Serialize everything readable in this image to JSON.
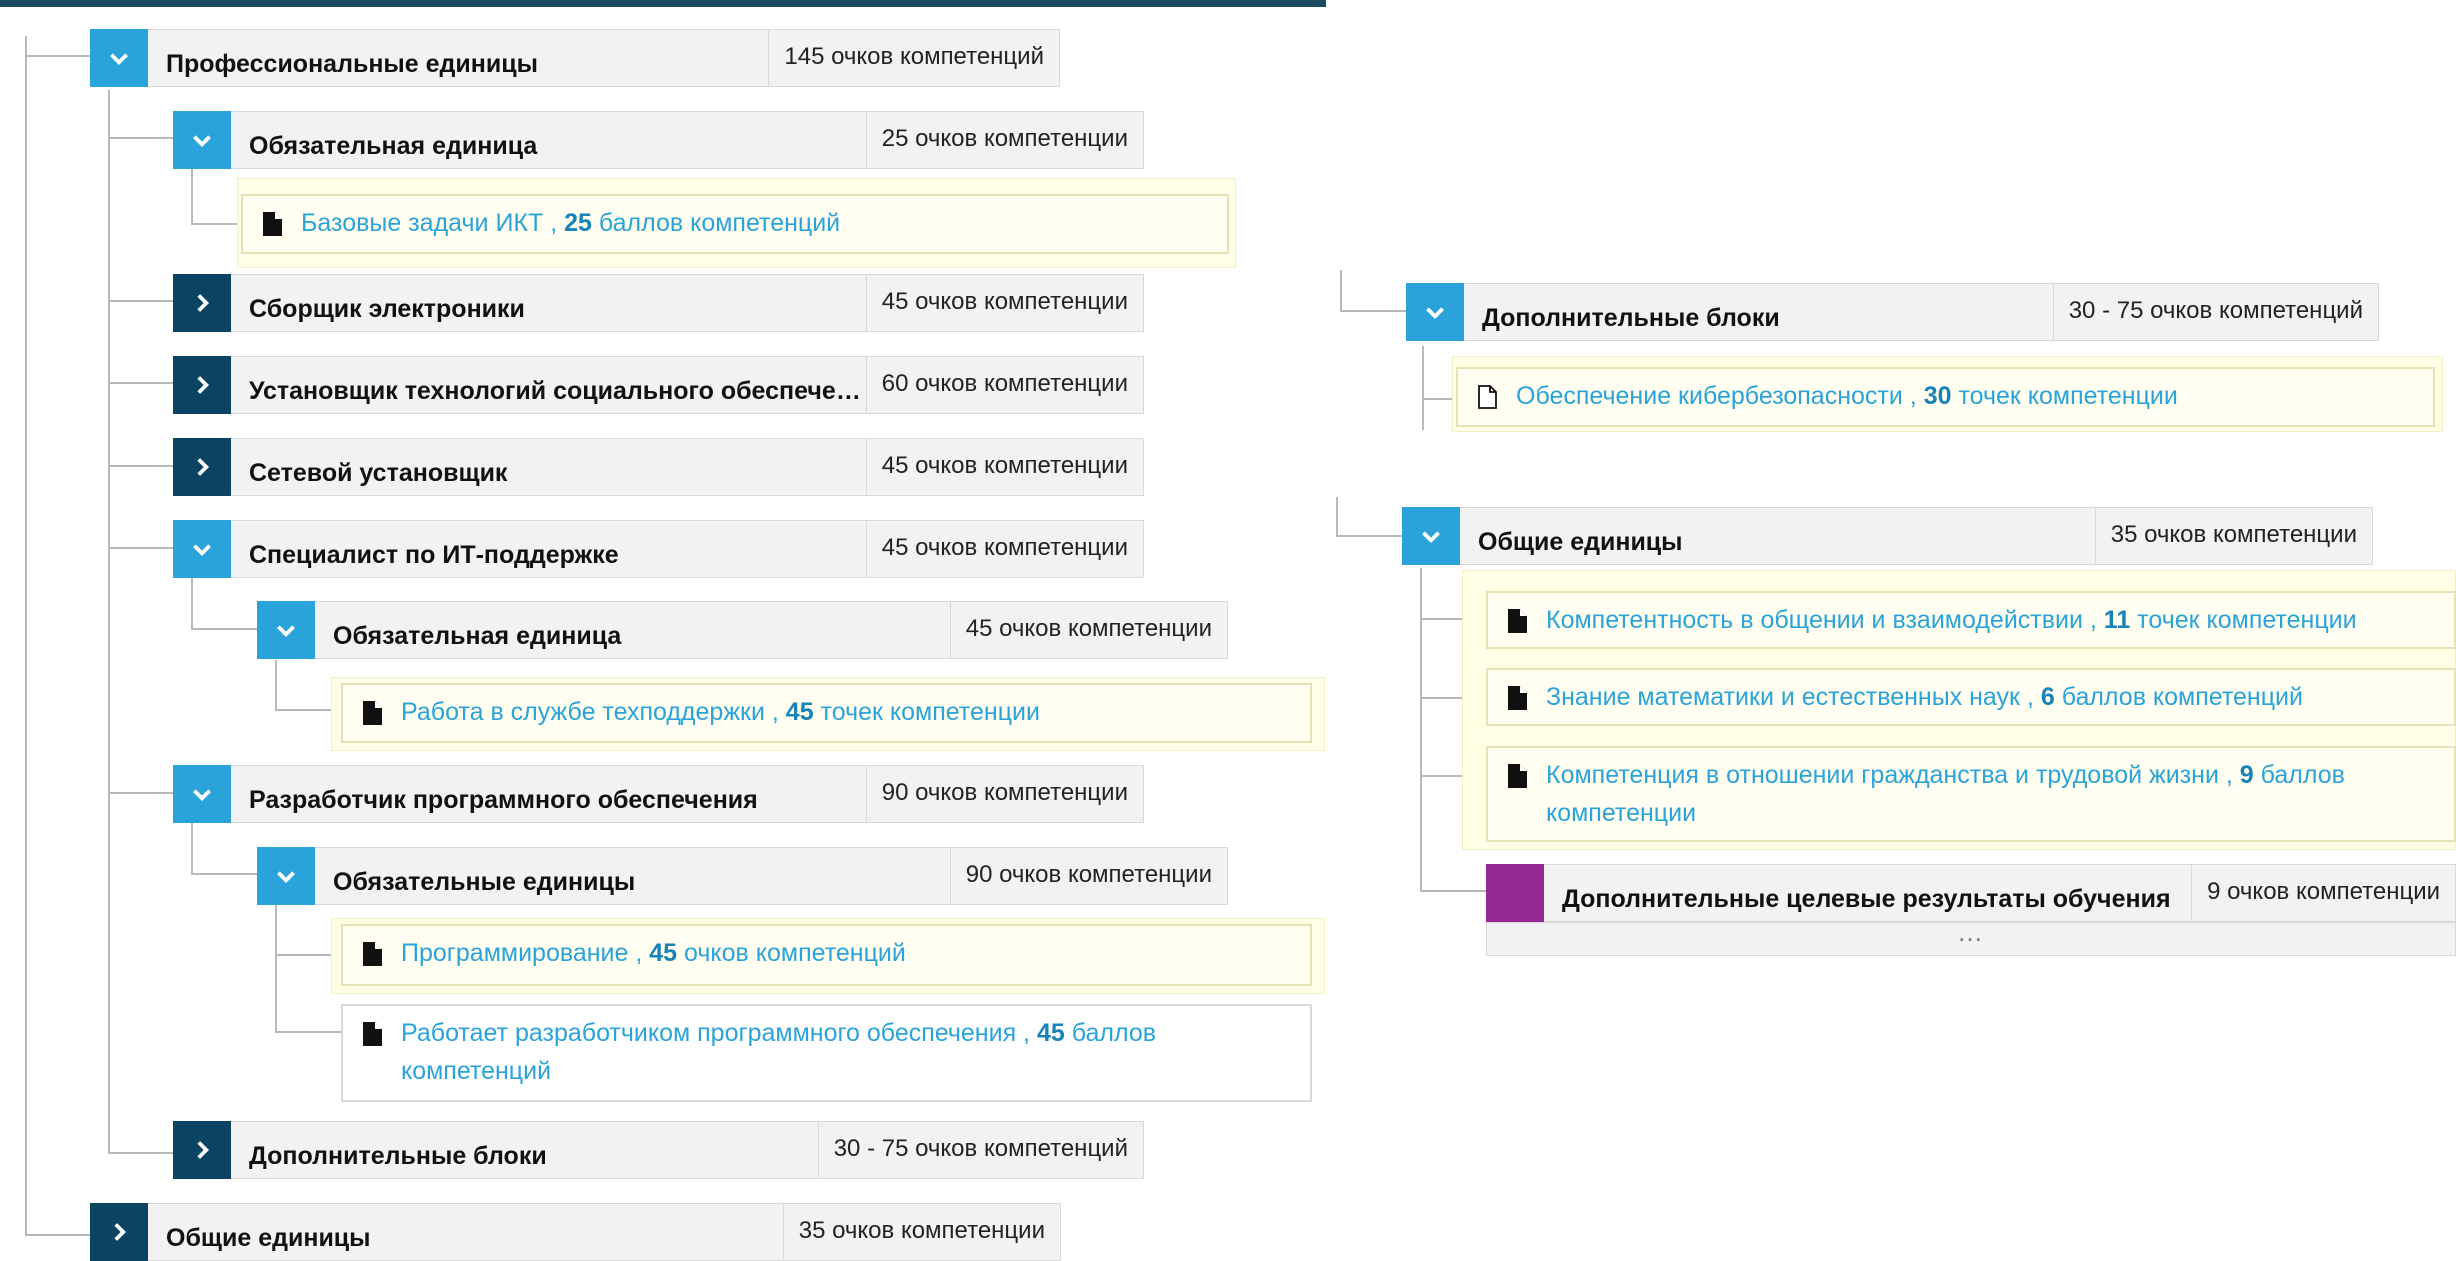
{
  "left": {
    "prof": {
      "title": "Профессиональные единицы",
      "points": "145 очков компетенций"
    },
    "mand1": {
      "title": "Обязательная единица",
      "points": "25 очков компетенции"
    },
    "leaf_ict": {
      "name": "Базовые задачи ИКТ",
      "sep": " , ",
      "num": "25",
      "unit": " баллов компетенций"
    },
    "elec": {
      "title": "Сборщик электроники",
      "points": "45 очков компетенции"
    },
    "social": {
      "title": "Установщик технологий социального обеспечения",
      "points": "60 очков компетенции"
    },
    "net": {
      "title": "Сетевой установщик",
      "points": "45 очков компетенции"
    },
    "itsup": {
      "title": "Специалист по ИТ-поддержке",
      "points": "45 очков компетенции"
    },
    "mand2": {
      "title": "Обязательная единица",
      "points": "45 очков компетенции"
    },
    "leaf_helpdesk": {
      "name": "Работа в службе техподдержки",
      "sep": " , ",
      "num": "45",
      "unit": " точек компетенции"
    },
    "dev": {
      "title": "Разработчик программного обеспечения",
      "points": "90 очков компетенции"
    },
    "mand3": {
      "title": "Обязательные единицы",
      "points": "90 очков компетенции"
    },
    "leaf_prog": {
      "name": "Программирование",
      "sep": " , ",
      "num": "45",
      "unit": " очков компетенций"
    },
    "leaf_devwork": {
      "name": "Работает разработчиком программного обеспечения",
      "sep": " , ",
      "num": "45",
      "unit": " баллов компетенций"
    },
    "extra": {
      "title": "Дополнительные блоки",
      "points": "30 - 75 очков компетенций"
    },
    "general": {
      "title": "Общие единицы",
      "points": "35 очков компетенции"
    }
  },
  "right": {
    "extra": {
      "title": "Дополнительные блоки",
      "points": "30 - 75 очков компетенций"
    },
    "leaf_cyber": {
      "name": "Обеспечение кибербезопасности",
      "sep": " , ",
      "num": "30",
      "unit": " точек компетенции"
    },
    "general": {
      "title": "Общие единицы",
      "points": "35 очков компетенции"
    },
    "leaf_comm": {
      "name": "Компетентность в общении и взаимодействии",
      "sep": " , ",
      "num": "11",
      "unit": " точек компетенции"
    },
    "leaf_math": {
      "name": "Знание математики и естественных наук",
      "sep": " , ",
      "num": "6",
      "unit": " баллов компетенций"
    },
    "leaf_civic": {
      "name": "Компетенция в отношении гражданства и трудовой жизни",
      "sep": " , ",
      "num": "9",
      "unit": " баллов компетенции"
    },
    "additional_goals": {
      "title": "Дополнительные целевые результаты обучения",
      "points": "9 очков компетенции"
    },
    "more_label": "…"
  },
  "icons": {
    "expanded": "chevron-down-icon",
    "collapsed": "chevron-right-icon",
    "file": "file-icon",
    "file_outline": "file-outline-icon"
  },
  "colors": {
    "open_toggle": "#2aa3db",
    "closed_toggle": "#0b4462",
    "purple_toggle": "#962895",
    "link": "#2aa3db",
    "leaf_bg": "#ffffe6"
  }
}
